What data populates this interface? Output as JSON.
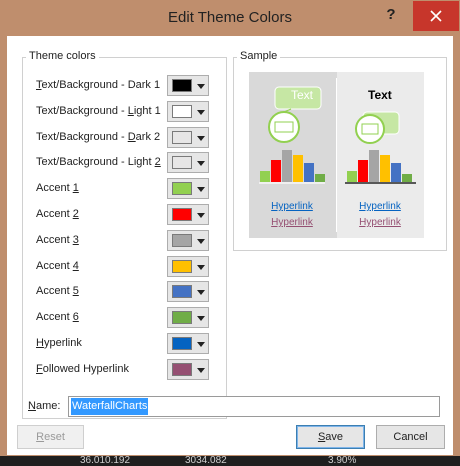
{
  "dialog": {
    "title": "Edit Theme Colors",
    "help_symbol": "?"
  },
  "theme_colors": {
    "group_label": "Theme colors",
    "items": [
      {
        "pre": "",
        "key": "T",
        "post": "ext/Background - Dark 1",
        "color": "#000000"
      },
      {
        "pre": "Text/Background - ",
        "key": "L",
        "post": "ight 1",
        "color": "#ffffff"
      },
      {
        "pre": "Text/Background - ",
        "key": "D",
        "post": "ark 2",
        "color": "#e7e6e6"
      },
      {
        "pre": "Text/Background - Light ",
        "key": "2",
        "post": "",
        "color": "#e7e6e6"
      },
      {
        "pre": "Accent ",
        "key": "1",
        "post": "",
        "color": "#92d050"
      },
      {
        "pre": "Accent ",
        "key": "2",
        "post": "",
        "color": "#ff0000"
      },
      {
        "pre": "Accent ",
        "key": "3",
        "post": "",
        "color": "#a5a5a5"
      },
      {
        "pre": "Accent ",
        "key": "4",
        "post": "",
        "color": "#ffc000"
      },
      {
        "pre": "Accent ",
        "key": "5",
        "post": "",
        "color": "#4472c4"
      },
      {
        "pre": "Accent ",
        "key": "6",
        "post": "",
        "color": "#70ad47"
      },
      {
        "pre": "",
        "key": "H",
        "post": "yperlink",
        "color": "#0563c1"
      },
      {
        "pre": "",
        "key": "F",
        "post": "ollowed Hyperlink",
        "color": "#954f72"
      }
    ]
  },
  "sample": {
    "group_label": "Sample",
    "left_text": "Text",
    "right_text": "Text",
    "hyperlink": "Hyperlink",
    "followed_hyperlink": "Hyperlink",
    "bar_colors": [
      "#92d050",
      "#ff0000",
      "#a5a5a5",
      "#ffc000",
      "#4472c4",
      "#70ad47"
    ],
    "bar_levels": [
      0.35,
      0.7,
      1.0,
      0.85,
      0.6,
      0.25
    ]
  },
  "name": {
    "label_key": "N",
    "label_rest": "ame:",
    "value": "WaterfallCharts"
  },
  "buttons": {
    "reset_key": "R",
    "reset_rest": "eset",
    "save_key": "S",
    "save_rest": "ave",
    "cancel": "Cancel"
  },
  "background_row": [
    "36.010.192",
    "3034.082",
    "3.90%"
  ]
}
